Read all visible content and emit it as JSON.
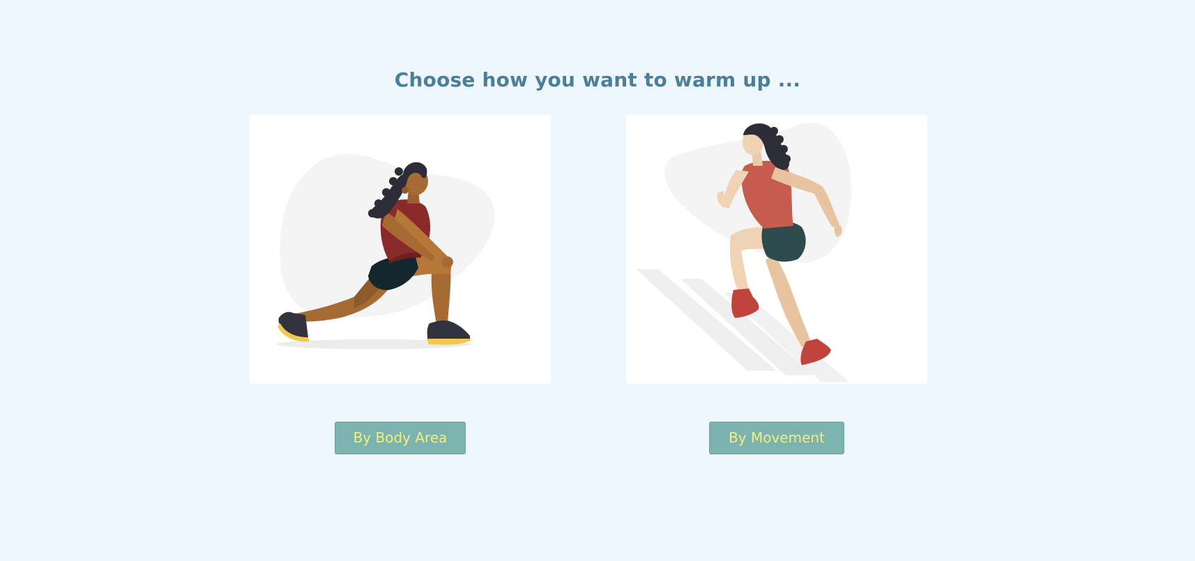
{
  "header": {
    "title": "Choose how you want to warm up ..."
  },
  "options": [
    {
      "illustration": "woman-lunge-stretch-illustration",
      "button_label": "By Body Area"
    },
    {
      "illustration": "woman-running-illustration",
      "button_label": "By Movement"
    }
  ],
  "colors": {
    "page_background": "#eef6fe",
    "title": "#4a7f99",
    "card_background": "#ffffff",
    "button_background": "#7cb2b0",
    "button_text": "#f3ef7d"
  }
}
